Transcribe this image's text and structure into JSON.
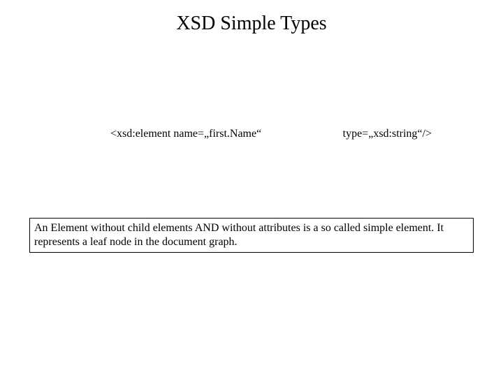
{
  "title": "XSD Simple Types",
  "code": {
    "left": "<xsd:element name=„first.Name“",
    "right": "type=„xsd:string“/>"
  },
  "description": "An Element without child elements AND without attributes is a so called simple element. It represents a leaf node in the document graph."
}
